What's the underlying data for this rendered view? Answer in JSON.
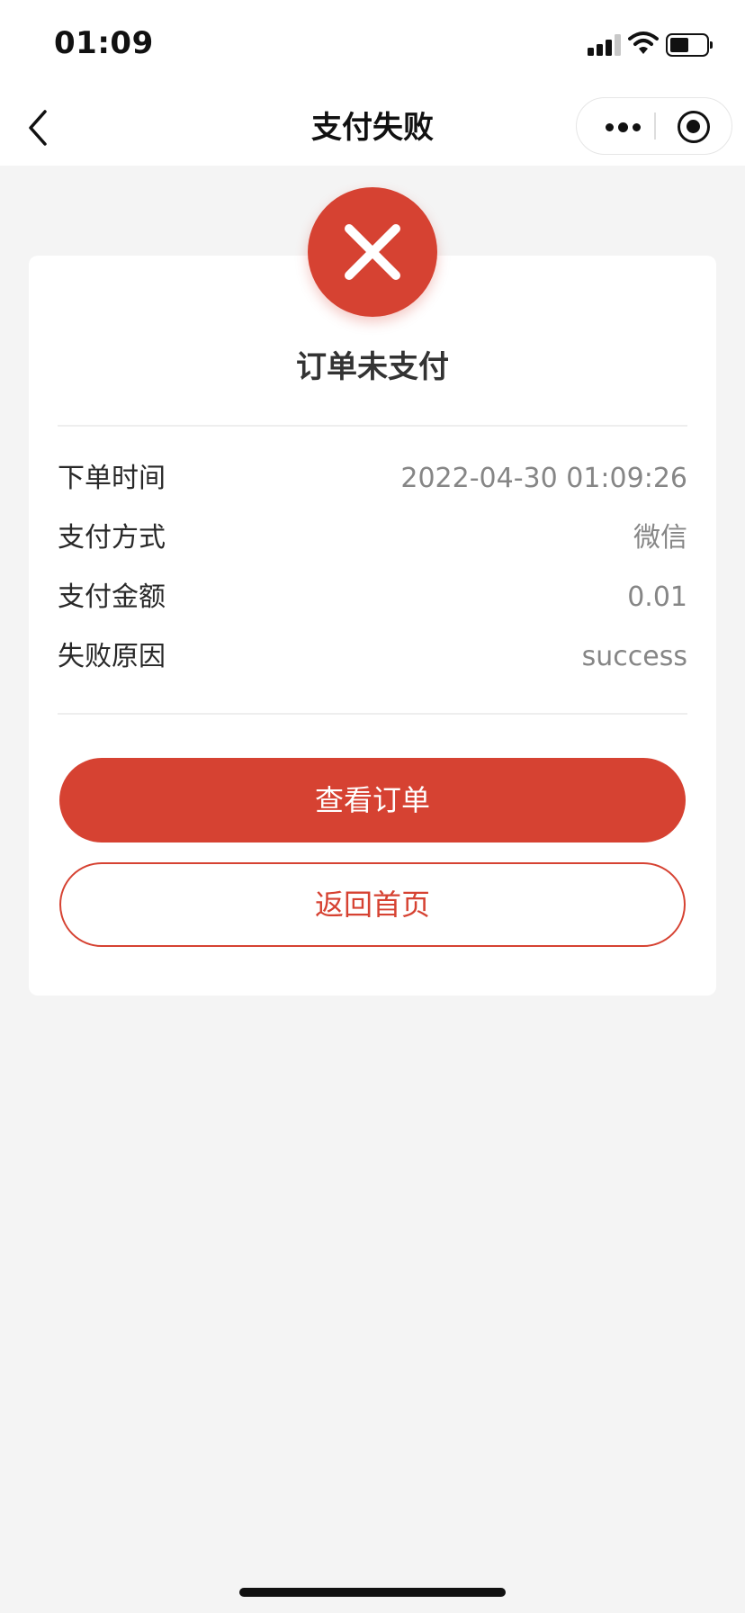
{
  "status_bar": {
    "time": "01:09"
  },
  "nav": {
    "title": "支付失败"
  },
  "result": {
    "title": "订单未支付",
    "details": [
      {
        "label": "下单时间",
        "value": "2022-04-30 01:09:26"
      },
      {
        "label": "支付方式",
        "value": "微信"
      },
      {
        "label": "支付金额",
        "value": "0.01"
      },
      {
        "label": "失败原因",
        "value": "success"
      }
    ]
  },
  "actions": {
    "view_order_label": "查看订单",
    "back_home_label": "返回首页"
  },
  "colors": {
    "accent": "#d64232",
    "background": "#f4f4f4",
    "card": "#ffffff",
    "value_text": "#868686"
  },
  "icons": {
    "back": "chevron-left-icon",
    "more": "more-dots-icon",
    "close_miniprogram": "target-circle-icon",
    "fail": "close-x-icon"
  }
}
